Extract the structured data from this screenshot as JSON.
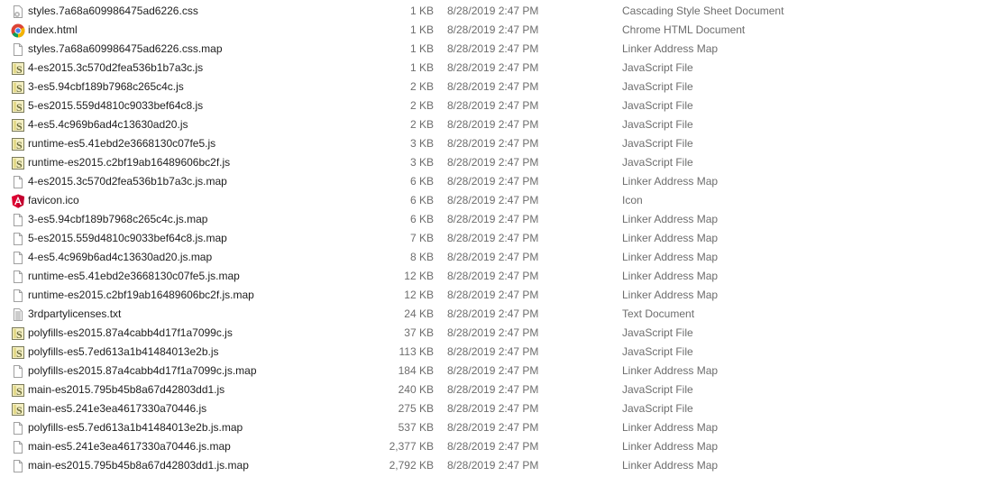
{
  "files": [
    {
      "name": "styles.7a68a609986475ad6226.css",
      "size": "1 KB",
      "date": "8/28/2019 2:47 PM",
      "type": "Cascading Style Sheet Document",
      "icon": "css-file-icon"
    },
    {
      "name": "index.html",
      "size": "1 KB",
      "date": "8/28/2019 2:47 PM",
      "type": "Chrome HTML Document",
      "icon": "chrome-icon"
    },
    {
      "name": "styles.7a68a609986475ad6226.css.map",
      "size": "1 KB",
      "date": "8/28/2019 2:47 PM",
      "type": "Linker Address Map",
      "icon": "blank-file-icon"
    },
    {
      "name": "4-es2015.3c570d2fea536b1b7a3c.js",
      "size": "1 KB",
      "date": "8/28/2019 2:47 PM",
      "type": "JavaScript File",
      "icon": "js-file-icon"
    },
    {
      "name": "3-es5.94cbf189b7968c265c4c.js",
      "size": "2 KB",
      "date": "8/28/2019 2:47 PM",
      "type": "JavaScript File",
      "icon": "js-file-icon"
    },
    {
      "name": "5-es2015.559d4810c9033bef64c8.js",
      "size": "2 KB",
      "date": "8/28/2019 2:47 PM",
      "type": "JavaScript File",
      "icon": "js-file-icon"
    },
    {
      "name": "4-es5.4c969b6ad4c13630ad20.js",
      "size": "2 KB",
      "date": "8/28/2019 2:47 PM",
      "type": "JavaScript File",
      "icon": "js-file-icon"
    },
    {
      "name": "runtime-es5.41ebd2e3668130c07fe5.js",
      "size": "3 KB",
      "date": "8/28/2019 2:47 PM",
      "type": "JavaScript File",
      "icon": "js-file-icon"
    },
    {
      "name": "runtime-es2015.c2bf19ab16489606bc2f.js",
      "size": "3 KB",
      "date": "8/28/2019 2:47 PM",
      "type": "JavaScript File",
      "icon": "js-file-icon"
    },
    {
      "name": "4-es2015.3c570d2fea536b1b7a3c.js.map",
      "size": "6 KB",
      "date": "8/28/2019 2:47 PM",
      "type": "Linker Address Map",
      "icon": "blank-file-icon"
    },
    {
      "name": "favicon.ico",
      "size": "6 KB",
      "date": "8/28/2019 2:47 PM",
      "type": "Icon",
      "icon": "angular-icon"
    },
    {
      "name": "3-es5.94cbf189b7968c265c4c.js.map",
      "size": "6 KB",
      "date": "8/28/2019 2:47 PM",
      "type": "Linker Address Map",
      "icon": "blank-file-icon"
    },
    {
      "name": "5-es2015.559d4810c9033bef64c8.js.map",
      "size": "7 KB",
      "date": "8/28/2019 2:47 PM",
      "type": "Linker Address Map",
      "icon": "blank-file-icon"
    },
    {
      "name": "4-es5.4c969b6ad4c13630ad20.js.map",
      "size": "8 KB",
      "date": "8/28/2019 2:47 PM",
      "type": "Linker Address Map",
      "icon": "blank-file-icon"
    },
    {
      "name": "runtime-es5.41ebd2e3668130c07fe5.js.map",
      "size": "12 KB",
      "date": "8/28/2019 2:47 PM",
      "type": "Linker Address Map",
      "icon": "blank-file-icon"
    },
    {
      "name": "runtime-es2015.c2bf19ab16489606bc2f.js.map",
      "size": "12 KB",
      "date": "8/28/2019 2:47 PM",
      "type": "Linker Address Map",
      "icon": "blank-file-icon"
    },
    {
      "name": "3rdpartylicenses.txt",
      "size": "24 KB",
      "date": "8/28/2019 2:47 PM",
      "type": "Text Document",
      "icon": "text-file-icon"
    },
    {
      "name": "polyfills-es2015.87a4cabb4d17f1a7099c.js",
      "size": "37 KB",
      "date": "8/28/2019 2:47 PM",
      "type": "JavaScript File",
      "icon": "js-file-icon"
    },
    {
      "name": "polyfills-es5.7ed613a1b41484013e2b.js",
      "size": "113 KB",
      "date": "8/28/2019 2:47 PM",
      "type": "JavaScript File",
      "icon": "js-file-icon"
    },
    {
      "name": "polyfills-es2015.87a4cabb4d17f1a7099c.js.map",
      "size": "184 KB",
      "date": "8/28/2019 2:47 PM",
      "type": "Linker Address Map",
      "icon": "blank-file-icon"
    },
    {
      "name": "main-es2015.795b45b8a67d42803dd1.js",
      "size": "240 KB",
      "date": "8/28/2019 2:47 PM",
      "type": "JavaScript File",
      "icon": "js-file-icon"
    },
    {
      "name": "main-es5.241e3ea4617330a70446.js",
      "size": "275 KB",
      "date": "8/28/2019 2:47 PM",
      "type": "JavaScript File",
      "icon": "js-file-icon"
    },
    {
      "name": "polyfills-es5.7ed613a1b41484013e2b.js.map",
      "size": "537 KB",
      "date": "8/28/2019 2:47 PM",
      "type": "Linker Address Map",
      "icon": "blank-file-icon"
    },
    {
      "name": "main-es5.241e3ea4617330a70446.js.map",
      "size": "2,377 KB",
      "date": "8/28/2019 2:47 PM",
      "type": "Linker Address Map",
      "icon": "blank-file-icon"
    },
    {
      "name": "main-es2015.795b45b8a67d42803dd1.js.map",
      "size": "2,792 KB",
      "date": "8/28/2019 2:47 PM",
      "type": "Linker Address Map",
      "icon": "blank-file-icon"
    }
  ]
}
